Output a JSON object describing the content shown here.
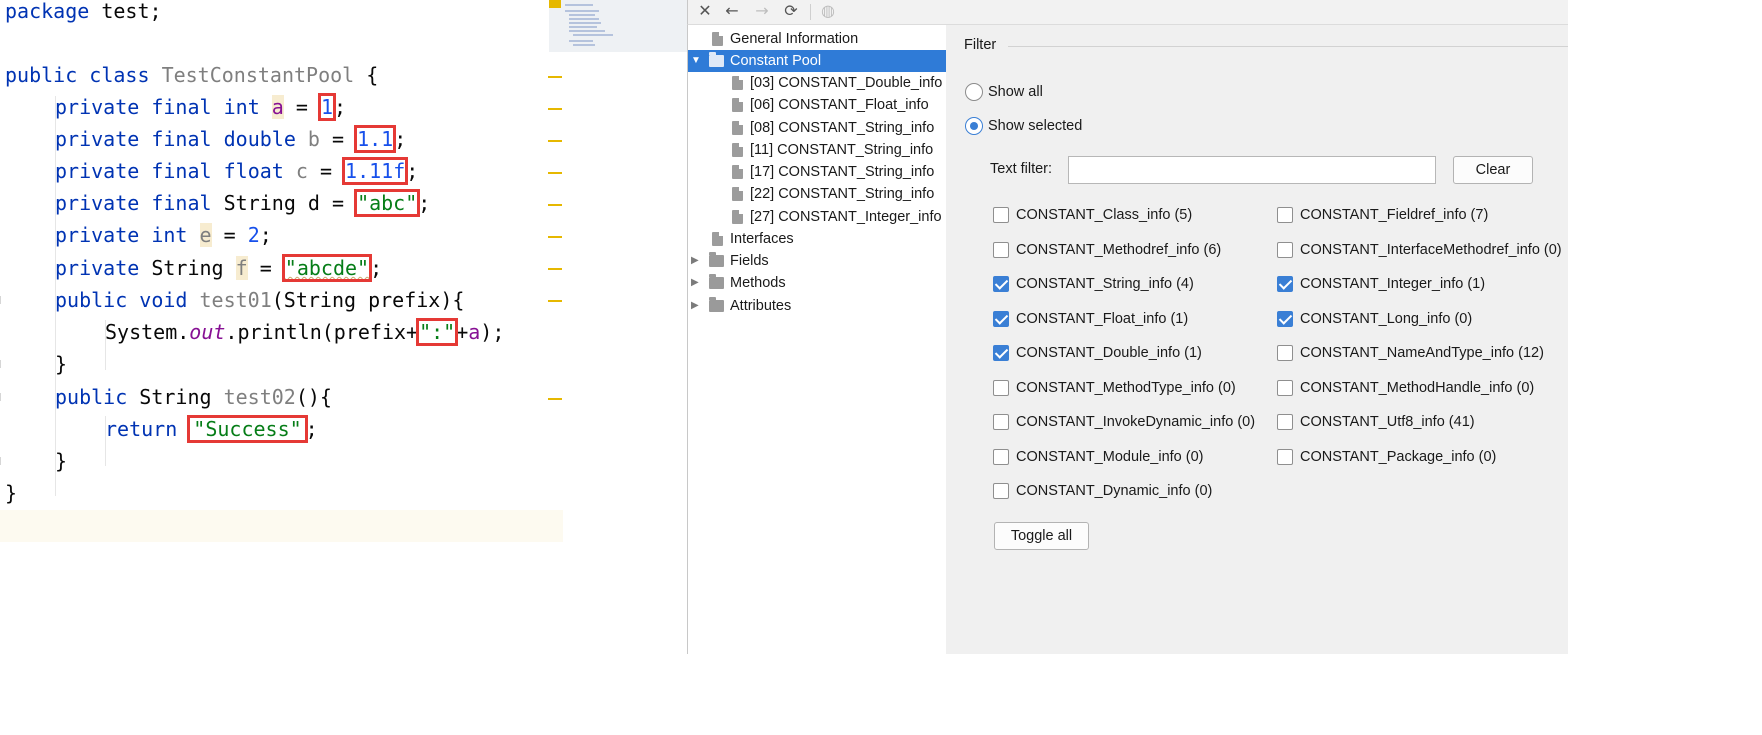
{
  "editor": {
    "lines": {
      "l1": [
        "package",
        " test;"
      ],
      "l2": [
        "public",
        " ",
        "class",
        " ",
        "TestConstantPool",
        " {"
      ],
      "l3": [
        "private",
        " ",
        "final",
        " ",
        "int",
        " ",
        "a",
        " = ",
        "1",
        ";"
      ],
      "l4": [
        "private",
        " ",
        "final",
        " ",
        "double",
        " ",
        "b",
        " = ",
        "1.1",
        ";"
      ],
      "l5": [
        "private",
        " ",
        "final",
        " ",
        "float",
        " ",
        "c",
        " = ",
        "1.11f",
        ";"
      ],
      "l6": [
        "private",
        " ",
        "final",
        " ",
        "String d = ",
        "\"abc\"",
        ";"
      ],
      "l7": [
        "private",
        " ",
        "int",
        " ",
        "e",
        " = ",
        "2",
        ";"
      ],
      "l8": [
        "private",
        " String ",
        "f",
        " = ",
        "\"abcde\"",
        ";"
      ],
      "l9": [
        "public",
        " ",
        "void",
        " ",
        "test01",
        "(String prefix){"
      ],
      "l10": [
        "System.",
        "out",
        ".println(prefix+",
        "\":\"",
        "+",
        "a",
        ");"
      ],
      "l11": [
        "}"
      ],
      "l12": [
        "public",
        " String ",
        "test02",
        "(){"
      ],
      "l13": [
        "return",
        " ",
        "\"Success\"",
        ";"
      ],
      "l14": [
        "}"
      ],
      "l15": [
        "}"
      ]
    }
  },
  "toolbar": {
    "close_glyph": "✕",
    "back_glyph": "←",
    "forward_glyph": "→",
    "refresh_glyph": "⟳",
    "browser_glyph": "◍"
  },
  "tree": {
    "general": "General Information",
    "constant_pool": "Constant Pool",
    "children": [
      "[03] CONSTANT_Double_info",
      "[06] CONSTANT_Float_info",
      "[08] CONSTANT_String_info",
      "[11] CONSTANT_String_info",
      "[17] CONSTANT_String_info",
      "[22] CONSTANT_String_info",
      "[27] CONSTANT_Integer_info"
    ],
    "interfaces": "Interfaces",
    "fields": "Fields",
    "methods": "Methods",
    "attributes": "Attributes",
    "expanded_arrow": "▼",
    "collapsed_arrow": "▶"
  },
  "filter": {
    "legend": "Filter",
    "show_all": "Show all",
    "show_selected": "Show selected",
    "selected_mode": "show_selected",
    "text_filter_label": "Text filter:",
    "text_filter_value": "",
    "clear_label": "Clear",
    "toggle_all_label": "Toggle all",
    "types": {
      "class_info": {
        "label": "CONSTANT_Class_info (5)",
        "checked": false
      },
      "fieldref_info": {
        "label": "CONSTANT_Fieldref_info (7)",
        "checked": false
      },
      "methodref_info": {
        "label": "CONSTANT_Methodref_info (6)",
        "checked": false
      },
      "interfacemethodref_info": {
        "label": "CONSTANT_InterfaceMethodref_info (0)",
        "checked": false
      },
      "string_info": {
        "label": "CONSTANT_String_info (4)",
        "checked": true
      },
      "integer_info": {
        "label": "CONSTANT_Integer_info (1)",
        "checked": true
      },
      "float_info": {
        "label": "CONSTANT_Float_info (1)",
        "checked": true
      },
      "long_info": {
        "label": "CONSTANT_Long_info (0)",
        "checked": true
      },
      "double_info": {
        "label": "CONSTANT_Double_info (1)",
        "checked": true
      },
      "nameandtype_info": {
        "label": "CONSTANT_NameAndType_info (12)",
        "checked": false
      },
      "methodtype_info": {
        "label": "CONSTANT_MethodType_info (0)",
        "checked": false
      },
      "methodhandle_info": {
        "label": "CONSTANT_MethodHandle_info (0)",
        "checked": false
      },
      "invokedynamic_info": {
        "label": "CONSTANT_InvokeDynamic_info (0)",
        "checked": false
      },
      "utf8_info": {
        "label": "CONSTANT_Utf8_info (41)",
        "checked": false
      },
      "module_info": {
        "label": "CONSTANT_Module_info (0)",
        "checked": false
      },
      "package_info": {
        "label": "CONSTANT_Package_info (0)",
        "checked": false
      },
      "dynamic_info": {
        "label": "CONSTANT_Dynamic_info (0)",
        "checked": false
      }
    }
  }
}
